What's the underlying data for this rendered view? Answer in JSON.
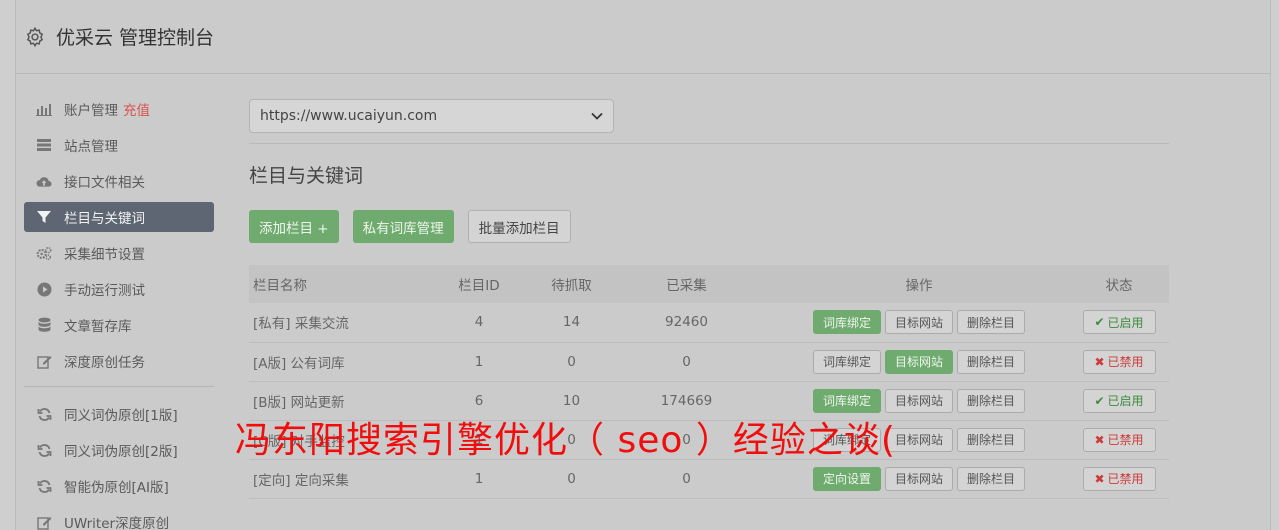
{
  "header": {
    "title": "优采云 管理控制台"
  },
  "sidebar": {
    "items": [
      {
        "label": "账户管理",
        "extra": "充值",
        "icon": "bar-chart-icon"
      },
      {
        "label": "站点管理",
        "icon": "server-icon"
      },
      {
        "label": "接口文件相关",
        "icon": "cloud-upload-icon"
      },
      {
        "label": "栏目与关键词",
        "icon": "filter-icon",
        "active": true
      },
      {
        "label": "采集细节设置",
        "icon": "gears-icon"
      },
      {
        "label": "手动运行测试",
        "icon": "play-circle-icon"
      },
      {
        "label": "文章暂存库",
        "icon": "database-icon"
      },
      {
        "label": "深度原创任务",
        "icon": "edit-icon"
      }
    ],
    "items2": [
      {
        "label": "同义词伪原创[1版]",
        "icon": "refresh-icon"
      },
      {
        "label": "同义词伪原创[2版]",
        "icon": "refresh-icon"
      },
      {
        "label": "智能伪原创[AI版]",
        "icon": "refresh-icon"
      },
      {
        "label": "UWriter深度原创",
        "icon": "edit-icon"
      }
    ]
  },
  "main": {
    "site_select": "https://www.ucaiyun.com",
    "section_title": "栏目与关键词",
    "buttons": {
      "add_column": "添加栏目 +",
      "private_lib": "私有词库管理",
      "batch_add": "批量添加栏目"
    },
    "table": {
      "headers": [
        "栏目名称",
        "栏目ID",
        "待抓取",
        "已采集",
        "操作",
        "状态"
      ],
      "rows": [
        {
          "name": "[私有] 采集交流",
          "id": "4",
          "pending": "14",
          "collected": "92460",
          "op1": "词库绑定",
          "op2": "目标网站",
          "op3": "删除栏目",
          "status": "已启用"
        },
        {
          "name": "[A版] 公有词库",
          "id": "1",
          "pending": "0",
          "collected": "0",
          "op1": "词库绑定",
          "op2": "目标网站",
          "op3": "删除栏目",
          "status": "已禁用"
        },
        {
          "name": "[B版] 网站更新",
          "id": "6",
          "pending": "10",
          "collected": "174669",
          "op1": "词库绑定",
          "op2": "目标网站",
          "op3": "删除栏目",
          "status": "已启用"
        },
        {
          "name": "[C版] 对手监控",
          "id": "1",
          "pending": "0",
          "collected": "0",
          "op1": "词库绑定",
          "op2": "目标网站",
          "op3": "删除栏目",
          "status": "已禁用"
        },
        {
          "name": "[定向] 定向采集",
          "id": "1",
          "pending": "0",
          "collected": "0",
          "op1": "定向设置",
          "op2": "目标网站",
          "op3": "删除栏目",
          "status": "已禁用"
        }
      ]
    }
  },
  "overlay": {
    "text": "冯东阳搜索引擎优化（ seo ）经验之谈("
  }
}
